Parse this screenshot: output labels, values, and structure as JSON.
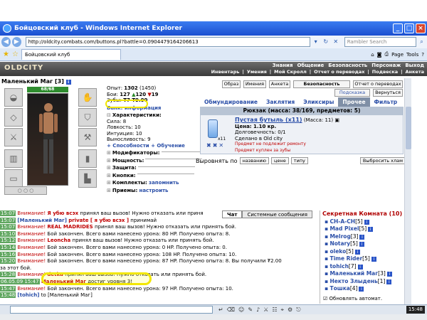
{
  "window": {
    "title": "Бойцовский клуб - Windows Internet Explorer",
    "url": "http://oldcity.combats.com/buttons.pl?battle=0.0904479164206613",
    "search_placeholder": "Rambler Search",
    "tab_title": "Бойцовский клуб",
    "page_label": "Page",
    "tools_label": "Tools"
  },
  "game_nav": {
    "logo": "OLDCITY",
    "top": [
      "Знания",
      "Общение",
      "Безопасность",
      "Персонаж",
      "Выход"
    ],
    "sub": [
      "Инвентарь",
      "Умения",
      "Мой Скролл",
      "Отчет о переводах",
      "Подвеска",
      "Анкета"
    ]
  },
  "character": {
    "name": "Маленький Маг",
    "level": "[3]",
    "hp": "68/68"
  },
  "stats": {
    "exp_label": "Опыт:",
    "exp_value": "1302",
    "exp_next": "(1450)",
    "fights_label": "Бои:",
    "fights_value": "127",
    "wins": "120",
    "losses": "19",
    "money_label": "Зубы:",
    "money_value": "₮7 ₮9.00",
    "bank": "Банк: информация",
    "section_chars": "Характеристики:",
    "str": "Сила: 8",
    "agi": "Ловкость: 10",
    "int": "Интуиция: 10",
    "end": "Выносливость: 9",
    "skills_link": "+ Способности + Обучение",
    "modifiers": "Модификаторы:",
    "power": "Мощность:",
    "protection": "Защита:",
    "buttons": "Кнопки:",
    "sets": "Комплекты:",
    "remember": "запомнить",
    "techniques": "Приемы:",
    "configure": "настроить"
  },
  "top_buttons": {
    "image": "Образ",
    "names": "Имения",
    "profile": "Анкета",
    "security": "Безопасность",
    "transfers": "Отчет о переводах",
    "pendant": "Подсказка",
    "return": "Вернуться"
  },
  "inventory": {
    "tabs": [
      "Обмундирование",
      "Заклятия",
      "Эликсиры",
      "Прочее",
      "Фильтр"
    ],
    "active_tab": "Прочее",
    "backpack": "Рюкзак (масса: 38/169, предметов: 5)",
    "item": {
      "name": "Пустая бутыль (x11)",
      "mass": "(Масса: 11)",
      "price": "Цена: 1.10 кр.",
      "durability": "Долговечность: 0/1",
      "made_in": "Сделано в Old city",
      "note1": "Предмет не подлежит ремонту",
      "note2": "Предмет куплен за зубы",
      "count": "x11"
    },
    "sort_label": "Выровнять по",
    "sort_buttons": [
      "названию",
      "цене",
      "типу"
    ],
    "trash_button": "Выбросить хлам"
  },
  "chat": {
    "tabs": [
      "Чат",
      "Системные сообщения"
    ],
    "lines": [
      {
        "ts": "15:07",
        "pre": "Внимание!",
        "nick": "Я убю всэх",
        "text": " принял ваш вызов! Нужно отказать или приня"
      },
      {
        "ts": "15:07",
        "pre": "[Маленький Маг]",
        "nick": "private [ я убю всэх ]",
        "text": " принимай"
      },
      {
        "ts": "15:07",
        "pre": "Внимание!",
        "nick": "REAL MADRIDES",
        "text": " принял ваш вызов! Нужно отказать или принять бой."
      },
      {
        "ts": "15:10",
        "pre": "Внимание!",
        "nick": "",
        "text": " Бой закончен. Всего вами нанесено урона: 80 HP. Получено опыта: 8."
      },
      {
        "ts": "15:12",
        "pre": "Внимание!",
        "nick": "Leoncha",
        "text": " принял ваш вызов! Нужно отказать или принять бой."
      },
      {
        "ts": "15:14",
        "pre": "Внимание!",
        "nick": "",
        "text": " Бой закончен. Всего вами нанесено урона: 0 HP. Получено опыта: 0."
      },
      {
        "ts": "15:16",
        "pre": "Внимание!",
        "nick": "",
        "text": " Бой закончен. Всего вами нанесено урона: 108 HP. Получено опыта: 10."
      },
      {
        "ts": "15:20",
        "pre": "Внимание!",
        "nick": "",
        "text": " Бой закончен. Всего вами нанесено урона: 87 HP. Получено опыта: 8. Вы получили ₮2.00"
      },
      {
        "ts": "",
        "pre": "",
        "nick": "",
        "text": "за этот бой."
      },
      {
        "ts": "15:28",
        "pre": "Внимание!",
        "nick": "detka",
        "text": " принял ваш вызов! Нужно отказать или принять бой."
      },
      {
        "ts": "06.05.09 15:47",
        "pre": "",
        "nick": "Маленький Маг",
        "text": " достиг уровня 3!"
      },
      {
        "ts": "15:47",
        "pre": "Внимание!",
        "nick": "",
        "text": " Бой закончен. Всего вами нанесено урона: 97 HP. Получено опыта: 10."
      },
      {
        "ts": "",
        "pre": "",
        "nick": "",
        "text": ""
      },
      {
        "ts": "15:48",
        "pre": "[tohich]",
        "nick": "",
        "text": " to [Маленький Маг]"
      }
    ]
  },
  "room": {
    "title": "Секретная Комната (10)",
    "users": [
      {
        "nick": "CH-A-CH",
        "lvl": "[5]"
      },
      {
        "nick": "Mad Pixel",
        "lvl": "[5]"
      },
      {
        "nick": "Melrog",
        "lvl": "[3]"
      },
      {
        "nick": "Notary",
        "lvl": "[5]"
      },
      {
        "nick": "oleko",
        "lvl": "[5]"
      },
      {
        "nick": "Time Rider",
        "lvl": "[5]"
      },
      {
        "nick": "tohich",
        "lvl": "[7]"
      },
      {
        "nick": "Маленький Маг",
        "lvl": "[3]"
      },
      {
        "nick": "Некто Злыдень",
        "lvl": "[1]"
      },
      {
        "nick": "Тошка",
        "lvl": "[4]"
      }
    ],
    "auto_update": "Обновлять автомат."
  },
  "clock": "15:48",
  "colors": {
    "link": "#2b4fa8",
    "alert": "#c00000",
    "highlight": "#f2e700",
    "timestamp_bg": "#5fa65f"
  }
}
